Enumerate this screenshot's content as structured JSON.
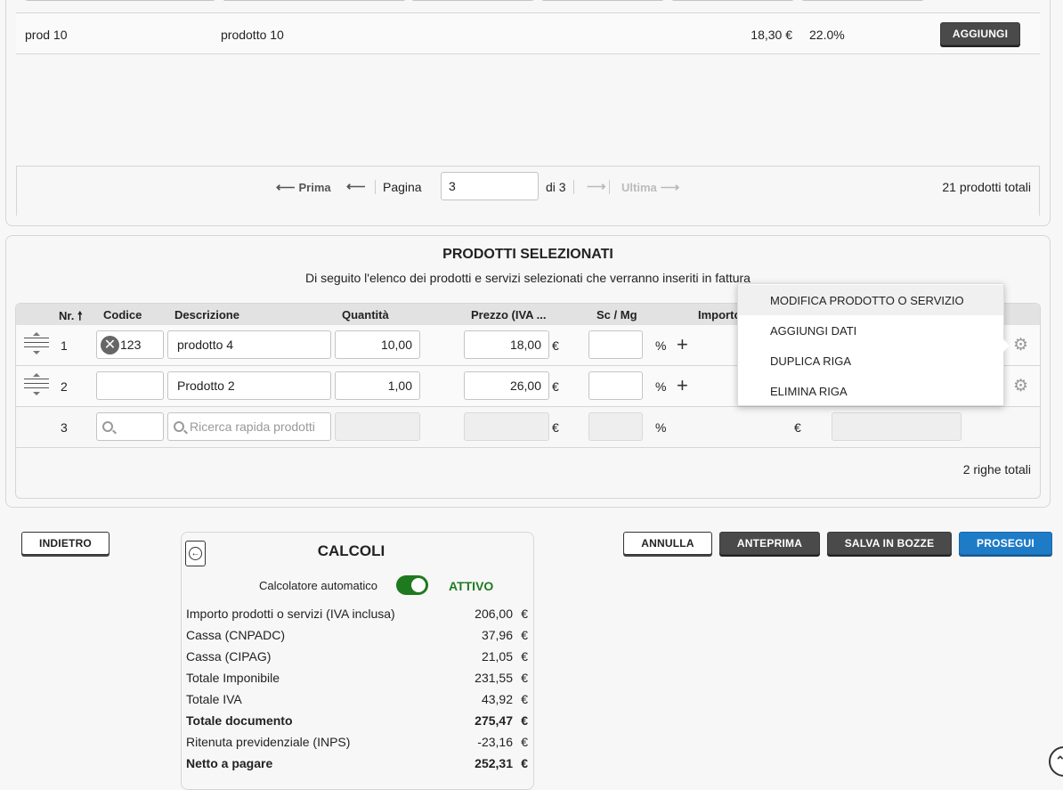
{
  "product_list": {
    "row": {
      "code": "prod 10",
      "description": "prodotto 10",
      "price": "18,30 €",
      "vat": "22.0%",
      "add_button": "AGGIUNGI"
    },
    "pagination": {
      "first": "Prima",
      "page_label": "Pagina",
      "page_value": "3",
      "of_label": "di 3",
      "last": "Ultima",
      "total": "21 prodotti totali"
    }
  },
  "selected": {
    "title": "PRODOTTI SELEZIONATI",
    "subtitle": "Di seguito l'elenco dei prodotti e servizi selezionati che verranno inseriti in fattura",
    "headers": {
      "nr": "Nr.",
      "codice": "Codice",
      "descrizione": "Descrizione",
      "quantita": "Quantità",
      "prezzo": "Prezzo (IVA ...",
      "sconto": "Sc / Mg",
      "importo": "Importo"
    },
    "sort_icon": "arrow-up-icon",
    "rows": [
      {
        "nr": "1",
        "code": "123",
        "description": "prodotto 4",
        "quantity": "10,00",
        "price": "18,00",
        "currency": "€",
        "percent": "%"
      },
      {
        "nr": "2",
        "code": "",
        "description": "Prodotto 2",
        "quantity": "1,00",
        "price": "26,00",
        "currency": "€",
        "percent": "%"
      }
    ],
    "new_row": {
      "nr": "3",
      "search_placeholder": "Ricerca rapida prodotti",
      "currency": "€",
      "percent": "%",
      "importo_currency": "€"
    },
    "total": "2 righe totali",
    "context_menu": [
      "MODIFICA PRODOTTO O SERVIZIO",
      "AGGIUNGI DATI",
      "DUPLICA RIGA",
      "ELIMINA RIGA"
    ]
  },
  "actions": {
    "back": "INDIETRO",
    "cancel": "ANNULLA",
    "preview": "ANTEPRIMA",
    "save_draft": "SALVA IN BOZZE",
    "continue": "PROSEGUI"
  },
  "calc": {
    "title": "CALCOLI",
    "auto_label": "Calcolatore automatico",
    "auto_state": "ATTIVO",
    "rows": [
      {
        "label": "Importo prodotti o servizi (IVA inclusa)",
        "value": "206,00",
        "cur": "€"
      },
      {
        "label": "Cassa (CNPADC)",
        "value": "37,96",
        "cur": "€"
      },
      {
        "label": "Cassa (CIPAG)",
        "value": "21,05",
        "cur": "€"
      },
      {
        "label": "Totale Imponibile",
        "value": "231,55",
        "cur": "€"
      },
      {
        "label": "Totale IVA",
        "value": "43,92",
        "cur": "€"
      },
      {
        "label": "Totale documento",
        "value": "275,47",
        "cur": "€"
      },
      {
        "label": "Ritenuta previdenziale (INPS)",
        "value": "-23,16",
        "cur": "€"
      },
      {
        "label": "Netto a pagare",
        "value": "252,31",
        "cur": "€"
      }
    ]
  },
  "colors": {
    "accent": "#1e7bc6",
    "toggle_on": "#1f7a1f",
    "dark_button": "#4a4a4a"
  }
}
